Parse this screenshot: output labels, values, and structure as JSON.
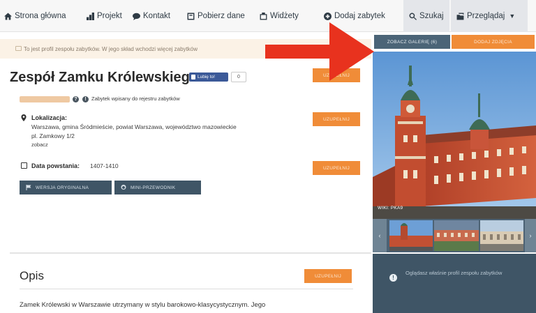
{
  "nav": {
    "items": [
      {
        "label": "Strona główna",
        "icon": "home-icon"
      },
      {
        "label": "Projekt",
        "icon": "bar-chart-icon"
      },
      {
        "label": "Kontakt",
        "icon": "speech-bubble-icon"
      },
      {
        "label": "Pobierz dane",
        "icon": "download-box-icon"
      },
      {
        "label": "Widżety",
        "icon": "widget-icon"
      },
      {
        "label": "Dodaj zabytek",
        "icon": "plus-circle-icon"
      },
      {
        "label": "Szukaj",
        "icon": "search-icon"
      },
      {
        "label": "Przeglądaj",
        "icon": "browse-icon"
      }
    ]
  },
  "notice": {
    "text": "To jest profil zespołu zabytków. W jego skład wchodzi więcej zabytków"
  },
  "monument": {
    "title": "Zespół Zamku Królewskiego",
    "fb_label": "Lubię to!",
    "fb_count": "0",
    "register_text": "Zabytek wpisany do rejestru zabytków",
    "location_label": "Lokalizacja:",
    "location_line1": "Warszawa, gmina Śródmieście, powiat Warszawa, województwo mazowieckie",
    "location_line2": "pl. Zamkowy 1/2",
    "location_link": "zobacz",
    "date_label": "Data powstania:",
    "date_value": "1407-1410",
    "uzupelnij": "UZUPEŁNIJ",
    "btn_original": "WERSJA ORYGINALNA",
    "btn_guide": "MINI-PRZEWODNIK"
  },
  "opis": {
    "title": "Opis",
    "uzupelnij": "UZUPEŁNIJ",
    "text": "Zamek Królewski w Warszawie utrzymany w stylu barokowo-klasycystycznym. Jego"
  },
  "gallery": {
    "tab_gallery": "ZOBACZ GALERIĘ (6)",
    "tab_add": "DODAJ ZDJĘCIA",
    "caption": "WIKI: PKA9",
    "prev": "‹",
    "next": "›",
    "info_text": "Oglądasz właśnie profil zespołu zabytków"
  },
  "colors": {
    "orange": "#f08c38",
    "slate": "#3f5566",
    "annotation_red": "#e8321e"
  }
}
